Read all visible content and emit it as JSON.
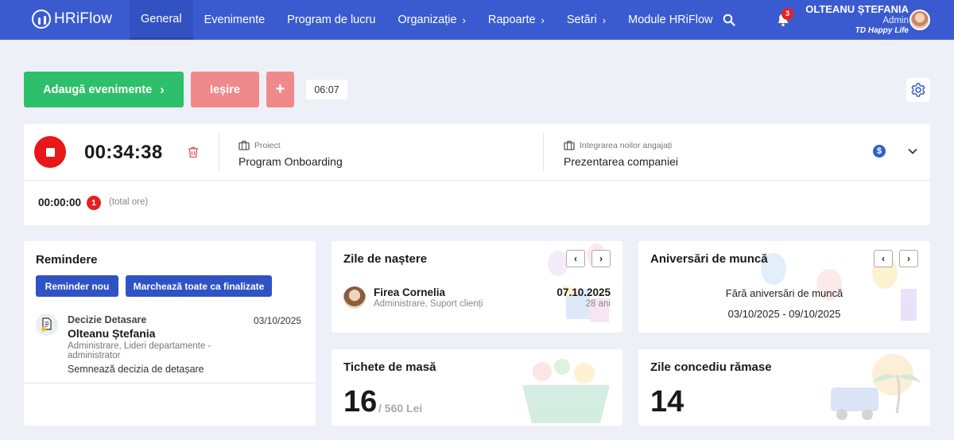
{
  "brand": {
    "name": "HRiFlow"
  },
  "nav": {
    "items": [
      {
        "label": "General",
        "active": true,
        "has_chevron": false
      },
      {
        "label": "Evenimente",
        "active": false,
        "has_chevron": false
      },
      {
        "label": "Program de lucru",
        "active": false,
        "has_chevron": false
      },
      {
        "label": "Organizație",
        "active": false,
        "has_chevron": true
      },
      {
        "label": "Rapoarte",
        "active": false,
        "has_chevron": true
      },
      {
        "label": "Setări",
        "active": false,
        "has_chevron": true
      },
      {
        "label": "Module HRiFlow",
        "active": false,
        "has_chevron": false
      }
    ],
    "chevron": "›",
    "notification_count": "3"
  },
  "user": {
    "name": "OLTEANU ȘTEFANIA",
    "role": "Admin",
    "company": "TD Happy Life"
  },
  "actions": {
    "add_events": "Adaugă evenimente",
    "add_events_arrow": "›",
    "exit": "Ieșire",
    "plus": "+",
    "clock": "06:07"
  },
  "timer": {
    "running_time": "00:34:38",
    "project_label": "Proiect",
    "project_value": "Program Onboarding",
    "task_label": "Integrarea noilor angajați",
    "task_value": "Prezentarea companiei",
    "currency_symbol": "$",
    "total_time": "00:00:00",
    "total_count": "1",
    "total_label": "(total ore)"
  },
  "reminders": {
    "title": "Remindere",
    "new_button": "Reminder nou",
    "mark_all_button": "Marchează toate ca finalizate",
    "item": {
      "type": "Decizie Detasare",
      "date": "03/10/2025",
      "person": "Olteanu Ștefania",
      "department": "Administrare, Lideri departamente -",
      "role": "administrator",
      "description": "Semnează decizia de detașare"
    }
  },
  "birthdays": {
    "title": "Zile de naștere",
    "prev": "‹",
    "next": "›",
    "item": {
      "name": "Firea Cornelia",
      "department": "Administrare, Suport clienți",
      "date": "07.10.2025",
      "age": "28 ani"
    }
  },
  "anniversaries": {
    "title": "Aniversări de muncă",
    "prev": "‹",
    "next": "›",
    "empty_text": "Fără aniversări de muncă",
    "range": "03/10/2025 - 09/10/2025"
  },
  "meal_tickets": {
    "title": "Tichete de masă",
    "count": "16",
    "amount": "/ 560 Lei"
  },
  "leave": {
    "title": "Zile concediu rămase",
    "days": "14"
  },
  "colors": {
    "nav_bg": "#3a5bd0",
    "green": "#2dbf6a",
    "salmon": "#f08a8a",
    "red": "#e81818",
    "primary": "#2f53c4"
  }
}
